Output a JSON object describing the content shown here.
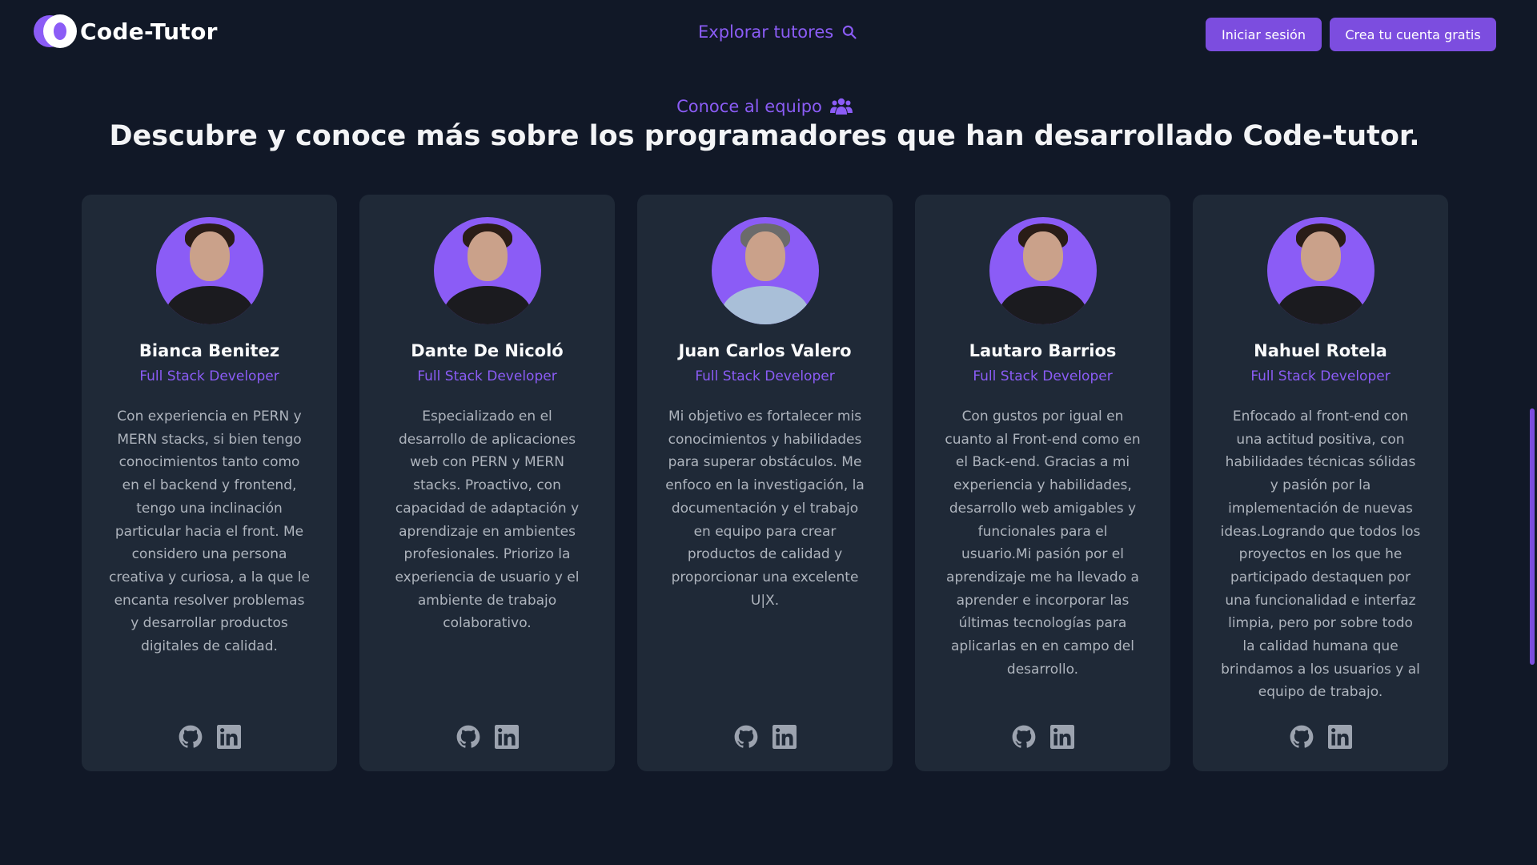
{
  "header": {
    "logo_text": "Code-Tutor",
    "explore_label": "Explorar tutores",
    "login_label": "Iniciar sesión",
    "signup_label": "Crea tu cuenta gratis"
  },
  "section": {
    "eyebrow": "Conoce al equipo",
    "title": "Descubre y conoce más sobre los programadores que han desarrollado Code-tutor."
  },
  "team": [
    {
      "name": "Bianca Benitez",
      "role": "Full Stack Developer",
      "bio": "Con experiencia en PERN y MERN stacks, si bien tengo conocimientos tanto como en el backend y frontend, tengo una inclinación particular hacia el front. Me considero una persona creativa y curiosa, a la que le encanta resolver problemas y desarrollar productos digitales de calidad."
    },
    {
      "name": "Dante De Nicoló",
      "role": "Full Stack Developer",
      "bio": "Especializado en el desarrollo de aplicaciones web con PERN y MERN stacks. Proactivo, con capacidad de adaptación y aprendizaje en ambientes profesionales. Priorizo la experiencia de usuario y el ambiente de trabajo colaborativo."
    },
    {
      "name": "Juan Carlos Valero",
      "role": "Full Stack Developer",
      "bio": "Mi objetivo es fortalecer mis conocimientos y habilidades para superar obstáculos. Me enfoco en la investigación, la documentación y el trabajo en equipo para crear productos de calidad y proporcionar una excelente U|X."
    },
    {
      "name": "Lautaro Barrios",
      "role": "Full Stack Developer",
      "bio": "Con gustos por igual en cuanto al Front-end como en el Back-end. Gracias a mi experiencia y habilidades, desarrollo web amigables y funcionales para el usuario.Mi pasión por el aprendizaje me ha llevado a aprender e incorporar las últimas tecnologías para aplicarlas en en campo del desarrollo."
    },
    {
      "name": "Nahuel Rotela",
      "role": "Full Stack Developer",
      "bio": "Enfocado al front-end con una actitud positiva, con habilidades técnicas sólidas y pasión por la implementación de nuevas ideas.Logrando que todos los proyectos en los que he participado destaquen por una funcionalidad e interfaz limpia, pero por sobre todo la calidad humana que brindamos a los usuarios y al equipo de trabajo."
    }
  ],
  "icons": {
    "explore": "search-icon",
    "eyebrow": "users-icon",
    "social_1": "github-icon",
    "social_2": "linkedin-icon"
  },
  "colors": {
    "accent": "#8b5cf6",
    "button": "#7c4ddf",
    "background": "#111827",
    "card": "#1f2937"
  }
}
